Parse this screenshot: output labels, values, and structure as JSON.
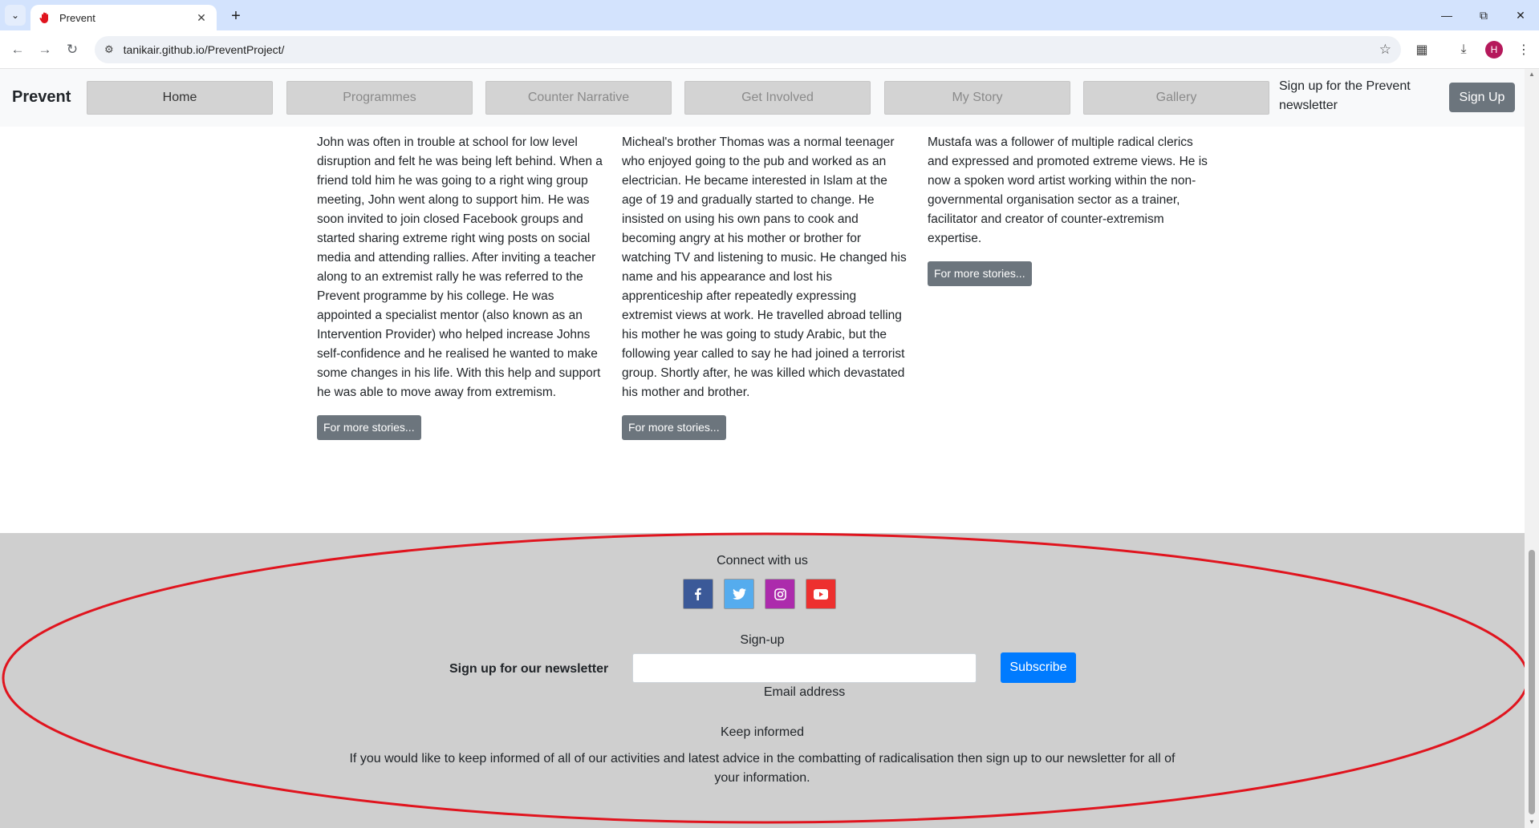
{
  "browser": {
    "tab_title": "Prevent",
    "url": "tanikair.github.io/PreventProject/",
    "avatar_letter": "H",
    "icons": {
      "tab_list": "chevron-down-icon",
      "favicon": "red-hand-icon",
      "tab_close": "close-icon",
      "new_tab": "plus-icon",
      "back": "back-arrow-icon",
      "forward": "forward-arrow-icon",
      "reload": "reload-icon",
      "site_info": "tune-icon",
      "bookmark": "star-icon",
      "extensions": "puzzle-icon",
      "downloads": "download-icon",
      "menu": "kebab-menu-icon"
    }
  },
  "navbar": {
    "brand": "Prevent",
    "items": [
      {
        "label": "Home",
        "active": true
      },
      {
        "label": "Programmes",
        "active": false
      },
      {
        "label": "Counter Narrative",
        "active": false
      },
      {
        "label": "Get Involved",
        "active": false
      },
      {
        "label": "My Story",
        "active": false
      },
      {
        "label": "Gallery",
        "active": false
      }
    ],
    "signup_text": "Sign up for the Prevent newsletter",
    "signup_button": "Sign Up"
  },
  "stories": [
    {
      "text": "John was often in trouble at school for low level disruption and felt he was being left behind. When a friend told him he was going to a right wing group meeting, John went along to support him. He was soon invited to join closed Facebook groups and started sharing extreme right wing posts on social media and attending rallies. After inviting a teacher along to an extremist rally he was referred to the Prevent programme by his college. He was appointed a specialist mentor (also known as an Intervention Provider) who helped increase Johns self-confidence and he realised he wanted to make some changes in his life. With this help and support he was able to move away from extremism.",
      "button": "For more stories..."
    },
    {
      "text": "Micheal's brother Thomas was a normal teenager who enjoyed going to the pub and worked as an electrician. He became interested in Islam at the age of 19 and gradually started to change. He insisted on using his own pans to cook and becoming angry at his mother or brother for watching TV and listening to music. He changed his name and his appearance and lost his apprenticeship after repeatedly expressing extremist views at work. He travelled abroad telling his mother he was going to study Arabic, but the following year called to say he had joined a terrorist group. Shortly after, he was killed which devastated his mother and brother.",
      "button": "For more stories..."
    },
    {
      "text": "Mustafa was a follower of multiple radical clerics and expressed and promoted extreme views. He is now a spoken word artist working within the non-governmental organisation sector as a trainer, facilitator and creator of counter-extremism expertise.",
      "button": "For more stories..."
    }
  ],
  "footer": {
    "connect_heading": "Connect with us",
    "social": [
      {
        "name": "facebook-icon",
        "color": "#3b5998"
      },
      {
        "name": "twitter-icon",
        "color": "#55acee"
      },
      {
        "name": "instagram-icon",
        "color": "#ac2bac"
      },
      {
        "name": "youtube-icon",
        "color": "#ed302f"
      }
    ],
    "signup_heading": "Sign-up",
    "newsletter_label": "Sign up for our newsletter",
    "email_value": "",
    "email_caption": "Email address",
    "subscribe_button": "Subscribe",
    "keep_heading": "Keep informed",
    "keep_text": "If you would like to keep informed of all of our activities and latest advice in the combatting of radicalisation then sign up to our newsletter for all of your information."
  },
  "colors": {
    "tabbar": "#d3e3fd",
    "nav_button": "#d3d3d3",
    "secondary_button": "#6c757d",
    "primary_button": "#007bff",
    "footer_bg": "#cfcfcf",
    "annotation": "#e0141e"
  }
}
